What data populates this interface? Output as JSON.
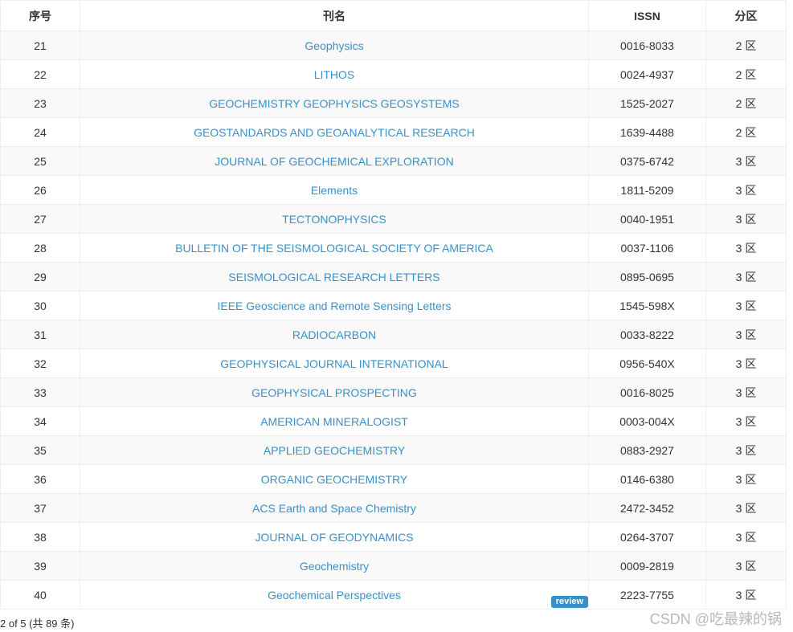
{
  "table": {
    "headers": {
      "no": "序号",
      "name": "刊名",
      "issn": "ISSN",
      "zone": "分区"
    },
    "rows": [
      {
        "no": "21",
        "name": "Geophysics",
        "issn": "0016-8033",
        "zone": "2 区"
      },
      {
        "no": "22",
        "name": "LITHOS",
        "issn": "0024-4937",
        "zone": "2 区"
      },
      {
        "no": "23",
        "name": "GEOCHEMISTRY GEOPHYSICS GEOSYSTEMS",
        "issn": "1525-2027",
        "zone": "2 区"
      },
      {
        "no": "24",
        "name": "GEOSTANDARDS AND GEOANALYTICAL RESEARCH",
        "issn": "1639-4488",
        "zone": "2 区"
      },
      {
        "no": "25",
        "name": "JOURNAL OF GEOCHEMICAL EXPLORATION",
        "issn": "0375-6742",
        "zone": "3 区"
      },
      {
        "no": "26",
        "name": "Elements",
        "issn": "1811-5209",
        "zone": "3 区"
      },
      {
        "no": "27",
        "name": "TECTONOPHYSICS",
        "issn": "0040-1951",
        "zone": "3 区"
      },
      {
        "no": "28",
        "name": "BULLETIN OF THE SEISMOLOGICAL SOCIETY OF AMERICA",
        "issn": "0037-1106",
        "zone": "3 区"
      },
      {
        "no": "29",
        "name": "SEISMOLOGICAL RESEARCH LETTERS",
        "issn": "0895-0695",
        "zone": "3 区"
      },
      {
        "no": "30",
        "name": "IEEE Geoscience and Remote Sensing Letters",
        "issn": "1545-598X",
        "zone": "3 区"
      },
      {
        "no": "31",
        "name": "RADIOCARBON",
        "issn": "0033-8222",
        "zone": "3 区"
      },
      {
        "no": "32",
        "name": "GEOPHYSICAL JOURNAL INTERNATIONAL",
        "issn": "0956-540X",
        "zone": "3 区"
      },
      {
        "no": "33",
        "name": "GEOPHYSICAL PROSPECTING",
        "issn": "0016-8025",
        "zone": "3 区"
      },
      {
        "no": "34",
        "name": "AMERICAN MINERALOGIST",
        "issn": "0003-004X",
        "zone": "3 区"
      },
      {
        "no": "35",
        "name": "APPLIED GEOCHEMISTRY",
        "issn": "0883-2927",
        "zone": "3 区"
      },
      {
        "no": "36",
        "name": "ORGANIC GEOCHEMISTRY",
        "issn": "0146-6380",
        "zone": "3 区"
      },
      {
        "no": "37",
        "name": "ACS Earth and Space Chemistry",
        "issn": "2472-3452",
        "zone": "3 区"
      },
      {
        "no": "38",
        "name": "JOURNAL OF GEODYNAMICS",
        "issn": "0264-3707",
        "zone": "3 区"
      },
      {
        "no": "39",
        "name": "Geochemistry",
        "issn": "0009-2819",
        "zone": "3 区"
      },
      {
        "no": "40",
        "name": "Geochemical Perspectives",
        "issn": "2223-7755",
        "zone": "3 区",
        "badge": "review"
      }
    ]
  },
  "pager": {
    "info": "2 of 5 (共 89 条)"
  },
  "watermark": "CSDN @吃最辣的锅",
  "colors": {
    "link": "#3a8fc7",
    "badge_bg": "#3a8fc7",
    "stripe": "#f9f9f9",
    "border": "#eeeeee"
  }
}
